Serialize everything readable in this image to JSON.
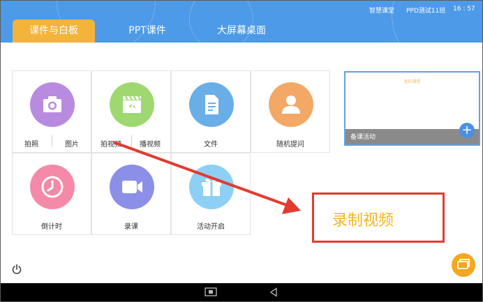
{
  "status": {
    "app_name": "智慧课堂",
    "class_name": "PPD测试11班",
    "time": "16 : 57"
  },
  "tabs": [
    {
      "label": "课件与白板",
      "active": true
    },
    {
      "label": "PPT课件",
      "active": false
    },
    {
      "label": "大屏幕桌面",
      "active": false
    }
  ],
  "tools": {
    "photo": {
      "icon": "camera-icon",
      "color": "#b98be0",
      "left_label": "拍照",
      "right_label": "图片"
    },
    "video": {
      "icon": "clapperboard-icon",
      "color": "#9fd870",
      "left_label": "拍视频",
      "right_label": "播视频"
    },
    "file": {
      "icon": "document-icon",
      "color": "#6aaee8",
      "label": "文件"
    },
    "random_question": {
      "icon": "person-icon",
      "color": "#f3a866",
      "label": "随机提问"
    },
    "countdown": {
      "icon": "clock-icon",
      "color": "#f48aa8",
      "label": "倒计时"
    },
    "record": {
      "icon": "video-camera-icon",
      "color": "#8b8fe8",
      "label": "录课"
    },
    "activity": {
      "icon": "gift-icon",
      "color": "#8ed0f5",
      "label": "活动开启"
    }
  },
  "prep_activity": {
    "small_title": "我的课程",
    "label": "备课活动",
    "plus": "+"
  },
  "callout": {
    "text": "录制视频"
  },
  "colors": {
    "header": "#4d9ae8",
    "active_tab": "#f3b43c",
    "annotation": "#e33a30",
    "accent_orange": "#f5a623"
  }
}
